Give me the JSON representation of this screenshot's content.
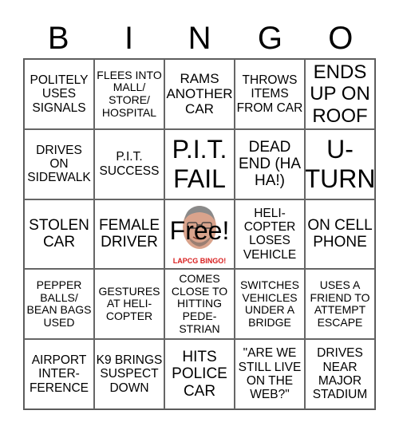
{
  "header": {
    "letters": [
      "B",
      "I",
      "N",
      "G",
      "O"
    ]
  },
  "cells": [
    [
      "POLITELY USES SIGNALS",
      "FLEES INTO MALL/ STORE/ HOSPITAL",
      "RAMS ANOTHER CAR",
      "THROWS ITEMS FROM CAR",
      "ENDS UP ON ROOF"
    ],
    [
      "DRIVES ON SIDEWALK",
      "P.I.T. SUCCESS",
      "P.I.T. FAIL",
      "DEAD END (HA HA!)",
      "U-TURN"
    ],
    [
      "STOLEN CAR",
      "FEMALE DRIVER",
      "Free!",
      "HELI-COPTER LOSES VEHICLE",
      "ON CELL PHONE"
    ],
    [
      "PEPPER BALLS/ BEAN BAGS USED",
      "GESTURES AT HELI-COPTER",
      "COMES CLOSE TO HITTING PEDE-STRIAN",
      "SWITCHES VEHICLES UNDER A BRIDGE",
      "USES A FRIEND TO ATTEMPT ESCAPE"
    ],
    [
      "AIRPORT INTER-FERENCE",
      "K9 BRINGS SUSPECT DOWN",
      "HITS POLICE CAR",
      "\"ARE WE STILL LIVE ON THE WEB?\"",
      "DRIVES NEAR MAJOR STADIUM"
    ]
  ],
  "free_space": {
    "label": "Free!",
    "tagline": "LAPCG BINGO!",
    "image": "face-photo",
    "tagline_color": "#d81e1e"
  }
}
